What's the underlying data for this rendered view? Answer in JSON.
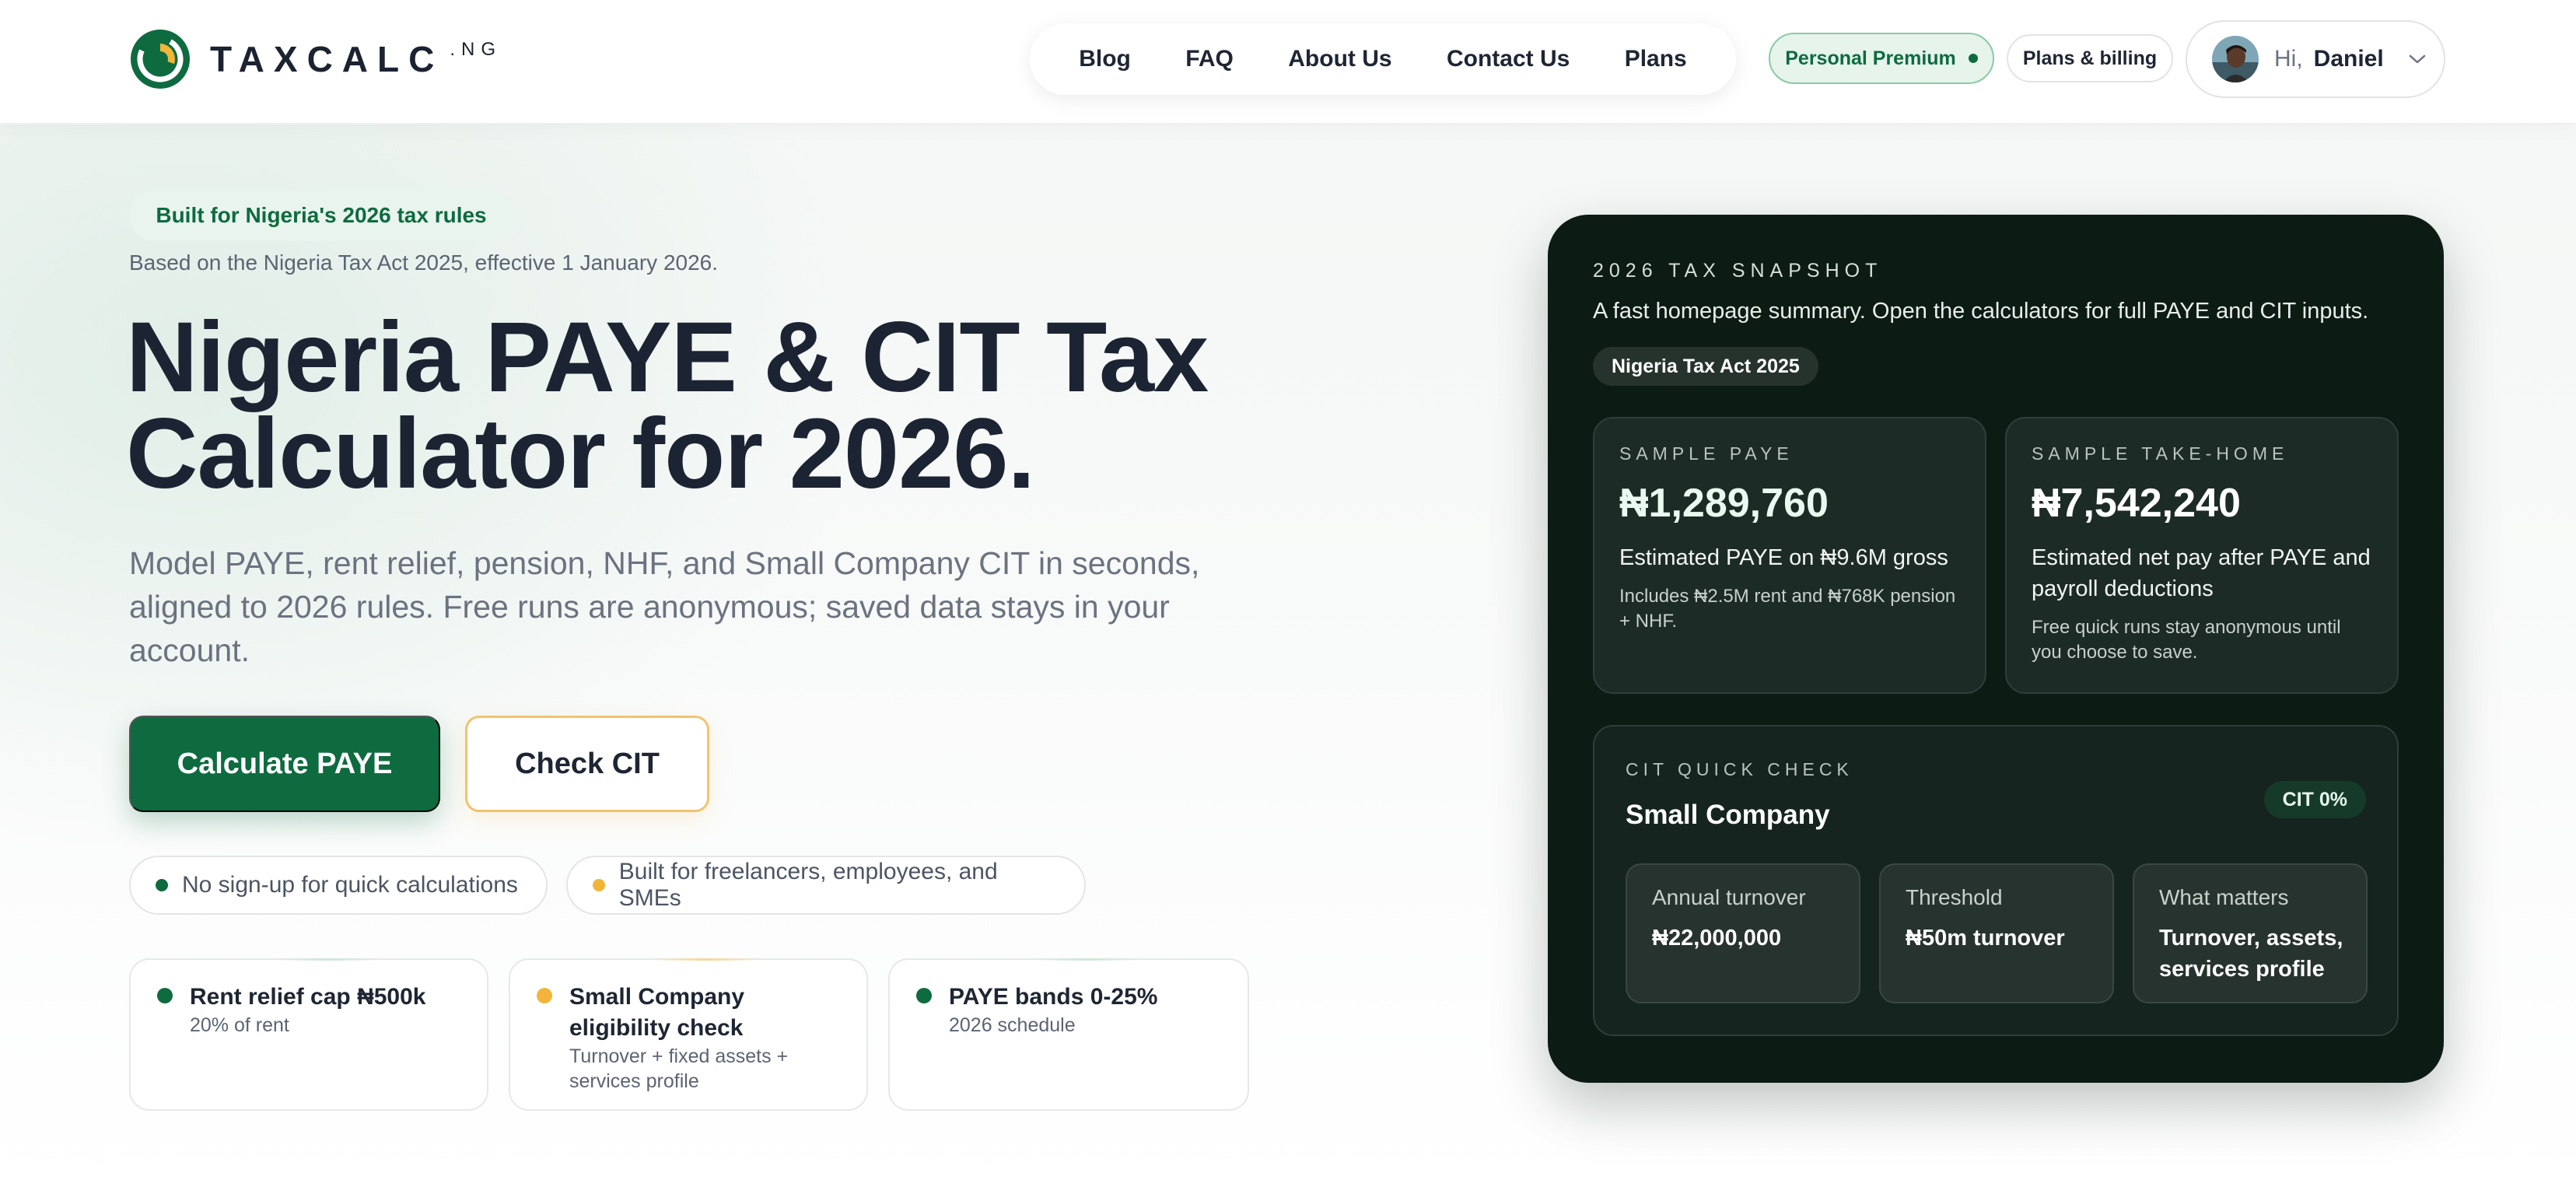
{
  "header": {
    "logo_text": "TAXCALC",
    "logo_suffix": ".NG",
    "nav": [
      "Blog",
      "FAQ",
      "About Us",
      "Contact Us",
      "Plans"
    ],
    "plan_badge": "Personal Premium",
    "billing_label": "Plans & billing",
    "greeting": "Hi,",
    "user_name": "Daniel"
  },
  "hero": {
    "tag": "Built for Nigeria's 2026 tax rules",
    "based_on": "Based on the Nigeria Tax Act 2025, effective 1 January 2026.",
    "title_line1": "Nigeria PAYE & CIT Tax",
    "title_line2": "Calculator for 2026.",
    "subtitle": "Model PAYE, rent relief, pension, NHF, and Small Company CIT in seconds, aligned to 2026 rules. Free runs are anonymous; saved data stays in your account.",
    "primary_cta": "Calculate PAYE",
    "secondary_cta": "Check CIT",
    "chips": [
      {
        "label": "No sign-up for quick calculations",
        "color": "#0e6b3f"
      },
      {
        "label": "Built for freelancers, employees, and SMEs",
        "color": "#f2b53a"
      }
    ],
    "features": [
      {
        "title": "Rent relief cap ₦500k",
        "subtitle": "20% of rent",
        "color": "#0e6b3f"
      },
      {
        "title": "Small Company eligibility check",
        "subtitle": "Turnover + fixed assets + services profile",
        "color": "#f2b53a"
      },
      {
        "title": "PAYE bands 0-25%",
        "subtitle": "2026 schedule",
        "color": "#0e6b3f"
      }
    ]
  },
  "snapshot": {
    "eyebrow": "2026 TAX SNAPSHOT",
    "subtitle": "A fast homepage summary. Open the calculators for full PAYE and CIT inputs.",
    "tag": "Nigeria Tax Act 2025",
    "paye": {
      "eyebrow": "SAMPLE PAYE",
      "value": "₦1,289,760",
      "desc": "Estimated PAYE on ₦9.6M gross",
      "note": "Includes ₦2.5M rent and ₦768K pension + NHF."
    },
    "takehome": {
      "eyebrow": "SAMPLE TAKE-HOME",
      "value": "₦7,542,240",
      "desc": "Estimated net pay after PAYE and payroll deductions",
      "note": "Free quick runs stay anonymous until you choose to save."
    },
    "cit": {
      "eyebrow": "CIT QUICK CHECK",
      "title": "Small Company",
      "badge": "CIT 0%",
      "items": [
        {
          "label": "Annual turnover",
          "value": "₦22,000,000"
        },
        {
          "label": "Threshold",
          "value": "₦50m turnover"
        },
        {
          "label": "What matters",
          "value": "Turnover, assets, services profile"
        }
      ]
    }
  },
  "colors": {
    "brand_green": "#0e6b3f",
    "accent_amber": "#f2b53a",
    "panel_dark": "#0d1b15"
  }
}
